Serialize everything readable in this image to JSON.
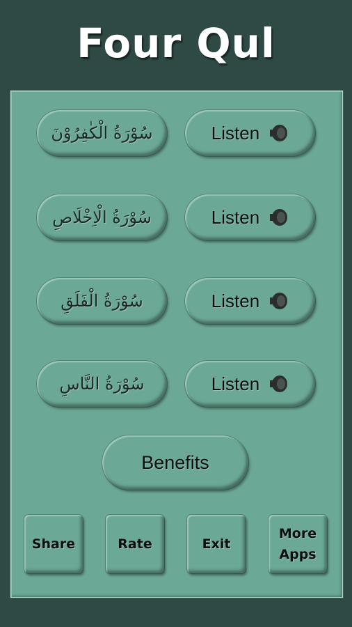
{
  "app": {
    "title": "Four Qul"
  },
  "surahs": [
    {
      "name": "سُوْرَةُ الْكٰفِرُوْنَ",
      "listen_label": "Listen"
    },
    {
      "name": "سُوْرَةُ الْاِخْلَاصِ",
      "listen_label": "Listen"
    },
    {
      "name": "سُوْرَةُ الْفَلَقِ",
      "listen_label": "Listen"
    },
    {
      "name": "سُوْرَةُ النَّاسِ",
      "listen_label": "Listen"
    }
  ],
  "benefits_label": "Benefits",
  "bottom_buttons": {
    "share": "Share",
    "rate": "Rate",
    "exit": "Exit",
    "more_apps": "More Apps"
  },
  "icons": {
    "listen": "speaker-icon"
  },
  "colors": {
    "background": "#2f4a44",
    "panel": "#6ba895",
    "title": "#ffffff"
  }
}
